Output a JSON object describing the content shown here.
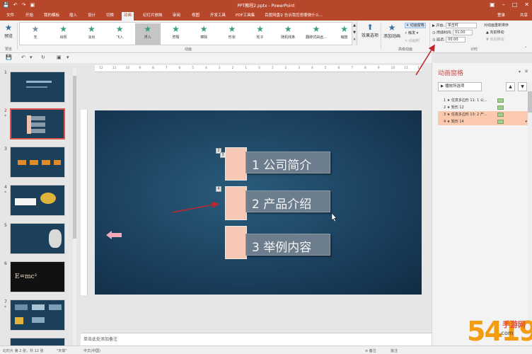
{
  "window": {
    "title": "PPT教程2.pptx - PowerPoint"
  },
  "qat": [
    "💾",
    "↶",
    "↷",
    "▣"
  ],
  "tabs": [
    "文件",
    "开始",
    "我的模板",
    "插入",
    "设计",
    "切换",
    "动画",
    "幻灯片放映",
    "审阅",
    "视图",
    "开发工具",
    "PDF工具集",
    "百度网盘"
  ],
  "tell_me": "♀ 告诉我您想要做什么...",
  "account": {
    "login": "登录",
    "share": "共享"
  },
  "ribbon": {
    "preview": {
      "label": "预览",
      "group": "预览"
    },
    "animations": [
      {
        "name": "无",
        "color": "#7a8fa3"
      },
      {
        "name": "出现",
        "color": "#3aa07a"
      },
      {
        "name": "淡出",
        "color": "#3aa07a"
      },
      {
        "name": "飞入",
        "color": "#3aa07a"
      },
      {
        "name": "浮入",
        "color": "#3aa07a"
      },
      {
        "name": "劈裂",
        "color": "#3aa07a"
      },
      {
        "name": "擦除",
        "color": "#3aa07a"
      },
      {
        "name": "形状",
        "color": "#3aa07a"
      },
      {
        "name": "轮子",
        "color": "#3aa07a"
      },
      {
        "name": "随机线条",
        "color": "#3aa07a"
      },
      {
        "name": "翻转式由远...",
        "color": "#3aa07a"
      },
      {
        "name": "缩放",
        "color": "#3aa07a"
      }
    ],
    "selected_animation": "浮入",
    "animation_group": "动画",
    "effect_options": "效果选项",
    "add_animation": "添加动画",
    "advanced": {
      "pane": "动画窗格",
      "trigger": "触发",
      "painter": "动画刷",
      "group": "高级动画"
    },
    "timing": {
      "start_label": "开始:",
      "start_value": "单击时",
      "duration_label": "持续时间:",
      "duration_value": "01.00",
      "delay_label": "延迟:",
      "delay_value": "00.00",
      "reorder": "对动画重新排序",
      "forward": "向前移动",
      "backward": "向后移动",
      "group": "计时"
    }
  },
  "ruler_ticks": [
    "12",
    "11",
    "10",
    "9",
    "8",
    "7",
    "6",
    "5",
    "4",
    "3",
    "2",
    "1",
    "0",
    "1",
    "2",
    "3",
    "4",
    "5",
    "6",
    "7",
    "8",
    "9",
    "10",
    "11",
    "12"
  ],
  "slides": [
    {
      "num": "1",
      "star": ""
    },
    {
      "num": "2",
      "star": "*"
    },
    {
      "num": "3",
      "star": ""
    },
    {
      "num": "4",
      "star": "*"
    },
    {
      "num": "5",
      "star": ""
    },
    {
      "num": "6",
      "star": ""
    },
    {
      "num": "7",
      "star": "*"
    }
  ],
  "slide": {
    "items": [
      {
        "text": "1 公司简介",
        "tag": "1"
      },
      {
        "text": "2 产品介绍",
        "tag": "4"
      },
      {
        "text": "3 举例内容",
        "tag": ""
      }
    ],
    "top_tags": [
      "2",
      "3"
    ]
  },
  "notes_placeholder": "单击此处添加备注",
  "anim_pane": {
    "title": "动画窗格",
    "play_button": "▶ 播放所选项",
    "up": "▲",
    "down": "▼",
    "items": [
      {
        "text": "1 ★ 任意多边形 11: 1 公...",
        "selected": false
      },
      {
        "text": "2 ★ 矩形 12",
        "selected": false
      },
      {
        "text": "3 ★ 任意多边形 13: 2 产...",
        "selected": true
      },
      {
        "text": "4 ★ 矩形 14",
        "selected": true
      }
    ]
  },
  "status": {
    "slide_info": "幻灯片 第 2 张，共 12 张",
    "theme": "\"天体\"",
    "language": "中文(中国)",
    "notes": "≡ 备注",
    "comments": "批注"
  },
  "watermark": {
    "big": "5419",
    "s1": "手游网",
    "s2": ".com"
  }
}
